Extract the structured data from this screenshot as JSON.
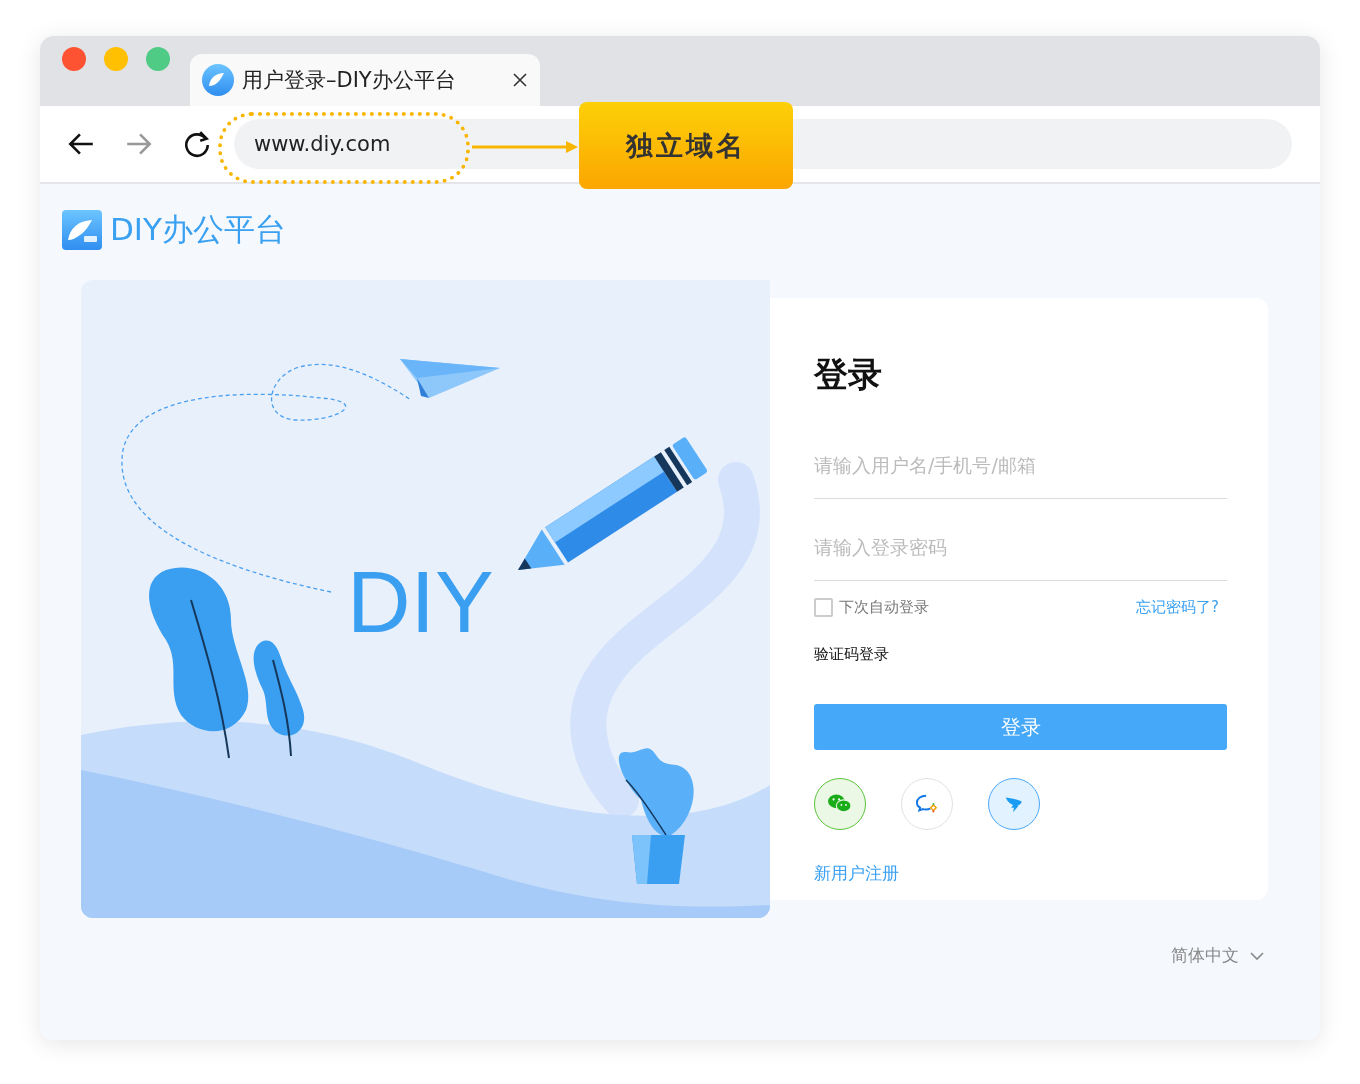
{
  "browser": {
    "tab": {
      "title": "用户登录–DIY办公平台"
    },
    "url": "www.diy.com"
  },
  "annotation": {
    "label": "独立域名"
  },
  "site": {
    "name": "DIY办公平台"
  },
  "illustration": {
    "text": "DIY"
  },
  "login": {
    "title": "登录",
    "username": {
      "placeholder": "请输入用户名/手机号/邮箱"
    },
    "password": {
      "placeholder": "请输入登录密码"
    },
    "remember": {
      "label": "下次自动登录",
      "checked": false
    },
    "forgot": "忘记密码了?",
    "sms_login": "验证码登录",
    "submit": "登录",
    "social": [
      {
        "kind": "wechat"
      },
      {
        "kind": "chat"
      },
      {
        "kind": "dingtalk"
      }
    ],
    "register": "新用户注册"
  },
  "language": "简体中文"
}
